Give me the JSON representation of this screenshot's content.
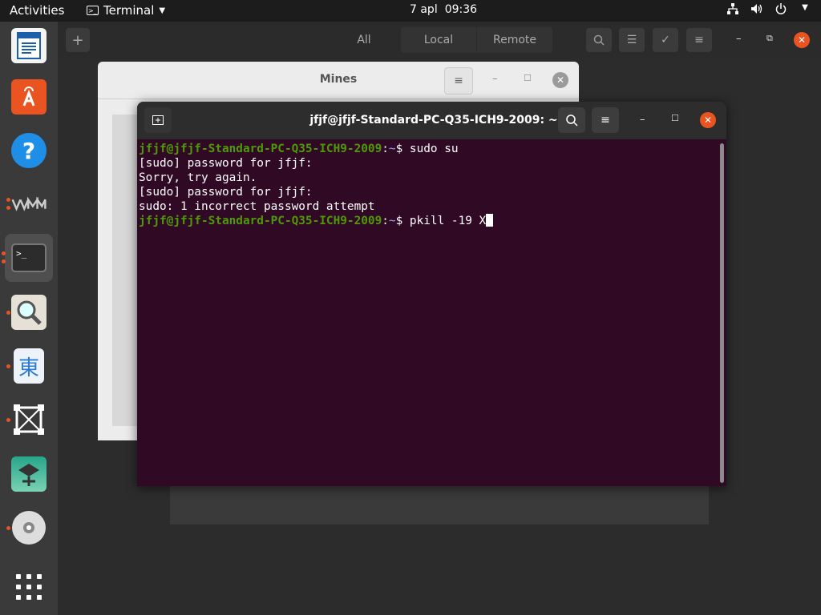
{
  "topbar": {
    "activities": "Activities",
    "app_name": "Terminal",
    "date": "7 apl",
    "time": "09:36"
  },
  "software": {
    "tab_all": "All",
    "tab_local": "Local",
    "tab_remote": "Remote"
  },
  "mines": {
    "title": "Mines"
  },
  "terminal": {
    "title": "jfjf@jfjf-Standard-PC-Q35-ICH9-2009: ~",
    "prompt_user_host": "jfjf@jfjf-Standard-PC-Q35-ICH9-2009",
    "prompt_sep": ":",
    "prompt_path": "~",
    "prompt_dollar": "$ ",
    "lines": [
      "[sudo] password for jfjf:",
      "Sorry, try again.",
      "[sudo] password for jfjf:",
      "sudo: 1 incorrect password attempt"
    ],
    "cmd1": "sudo su",
    "cmd2": "pkill -19 X"
  },
  "dock": {
    "items": [
      "text-editor-icon",
      "software-store-icon",
      "help-icon",
      "vm-icon",
      "terminal-icon",
      "image-viewer-icon",
      "input-method-icon",
      "transform-icon",
      "game-icon",
      "disc-icon",
      "app-grid-icon"
    ]
  },
  "colors": {
    "terminal_bg": "#300a24",
    "accent": "#e95420",
    "prompt_green": "#4e9a06"
  }
}
